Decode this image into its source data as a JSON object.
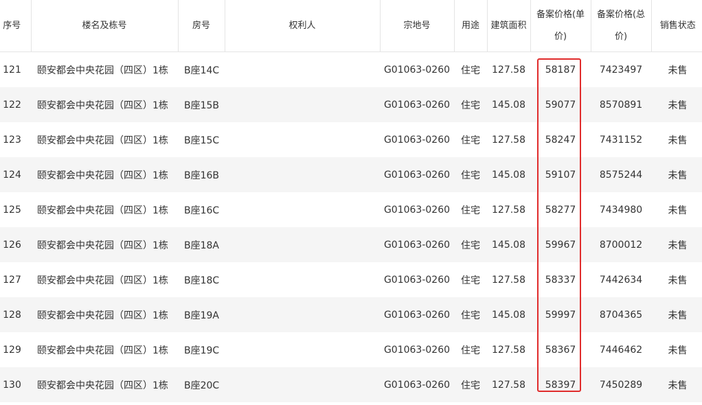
{
  "table": {
    "headers": {
      "index": "序号",
      "building": "楼名及栋号",
      "room": "房号",
      "owner": "权利人",
      "parcel": "宗地号",
      "usage": "用途",
      "area": "建筑面积",
      "unit_price": "备案价格(单价)",
      "total_price": "备案价格(总价)",
      "status": "销售状态"
    },
    "rows": [
      {
        "index": "121",
        "building": "颐安都会中央花园（四区）1栋",
        "room": "B座14C",
        "owner": "",
        "parcel": "G01063-0260",
        "usage": "住宅",
        "area": "127.58",
        "unit_price": "58187",
        "total_price": "7423497",
        "status": "未售"
      },
      {
        "index": "122",
        "building": "颐安都会中央花园（四区）1栋",
        "room": "B座15B",
        "owner": "",
        "parcel": "G01063-0260",
        "usage": "住宅",
        "area": "145.08",
        "unit_price": "59077",
        "total_price": "8570891",
        "status": "未售"
      },
      {
        "index": "123",
        "building": "颐安都会中央花园（四区）1栋",
        "room": "B座15C",
        "owner": "",
        "parcel": "G01063-0260",
        "usage": "住宅",
        "area": "127.58",
        "unit_price": "58247",
        "total_price": "7431152",
        "status": "未售"
      },
      {
        "index": "124",
        "building": "颐安都会中央花园（四区）1栋",
        "room": "B座16B",
        "owner": "",
        "parcel": "G01063-0260",
        "usage": "住宅",
        "area": "145.08",
        "unit_price": "59107",
        "total_price": "8575244",
        "status": "未售"
      },
      {
        "index": "125",
        "building": "颐安都会中央花园（四区）1栋",
        "room": "B座16C",
        "owner": "",
        "parcel": "G01063-0260",
        "usage": "住宅",
        "area": "127.58",
        "unit_price": "58277",
        "total_price": "7434980",
        "status": "未售"
      },
      {
        "index": "126",
        "building": "颐安都会中央花园（四区）1栋",
        "room": "B座18A",
        "owner": "",
        "parcel": "G01063-0260",
        "usage": "住宅",
        "area": "145.08",
        "unit_price": "59967",
        "total_price": "8700012",
        "status": "未售"
      },
      {
        "index": "127",
        "building": "颐安都会中央花园（四区）1栋",
        "room": "B座18C",
        "owner": "",
        "parcel": "G01063-0260",
        "usage": "住宅",
        "area": "127.58",
        "unit_price": "58337",
        "total_price": "7442634",
        "status": "未售"
      },
      {
        "index": "128",
        "building": "颐安都会中央花园（四区）1栋",
        "room": "B座19A",
        "owner": "",
        "parcel": "G01063-0260",
        "usage": "住宅",
        "area": "145.08",
        "unit_price": "59997",
        "total_price": "8704365",
        "status": "未售"
      },
      {
        "index": "129",
        "building": "颐安都会中央花园（四区）1栋",
        "room": "B座19C",
        "owner": "",
        "parcel": "G01063-0260",
        "usage": "住宅",
        "area": "127.58",
        "unit_price": "58367",
        "total_price": "7446462",
        "status": "未售"
      },
      {
        "index": "130",
        "building": "颐安都会中央花园（四区）1栋",
        "room": "B座20C",
        "owner": "",
        "parcel": "G01063-0260",
        "usage": "住宅",
        "area": "127.58",
        "unit_price": "58397",
        "total_price": "7450289",
        "status": "未售"
      }
    ]
  },
  "highlight": {
    "color": "#e02b2b",
    "target_column": "unit_price"
  },
  "colors": {
    "stripe": "#f5f5f5",
    "border": "#e4e4e4",
    "text": "#333333"
  }
}
